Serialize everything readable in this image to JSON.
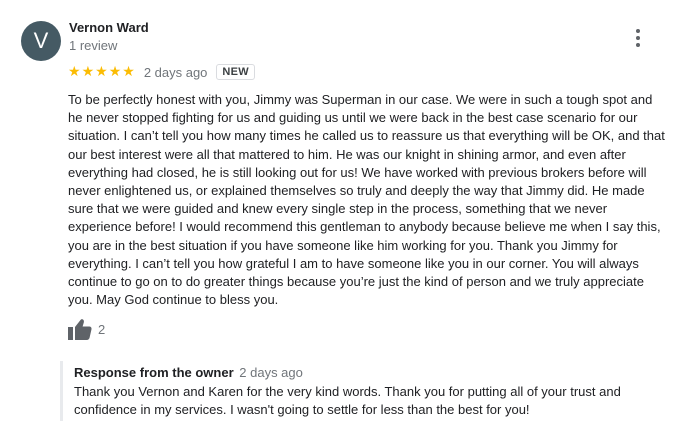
{
  "review": {
    "avatar_initial": "V",
    "avatar_color": "#455a64",
    "reviewer_name": "Vernon Ward",
    "review_count": "1 review",
    "rating": 5,
    "star_color": "#fbbc04",
    "date": "2 days ago",
    "badge": "NEW",
    "text": "To be perfectly honest with you, Jimmy was Superman in our case. We were in such a tough spot and he never stopped fighting for us and guiding us until we were back in  the best case scenario for our situation. I can’t tell you how many times he called us to reassure us that everything will be OK, and that our best interest were  all that mattered to him. He was our knight in shining armor, and even after everything had closed, he is still looking out for us! We have worked with previous brokers before will never enlightened us, or explained themselves so truly and deeply the way that Jimmy did. He made sure that we were guided and knew every single step in the process, something that we never experience before! I would recommend this gentleman to anybody because believe me when I say this, you are in the best situation if you have someone like him working for you. Thank you Jimmy for everything. I can’t tell you how grateful I am to have someone like you in our corner. You will always continue to go on to do greater things because you’re just the kind of person and we truly appreciate you. May God continue to bless you.",
    "like_count": "2",
    "more_icon": "more-vert-icon",
    "like_icon": "thumb-up-icon"
  },
  "owner_response": {
    "title": "Response from the owner",
    "date": "2 days ago",
    "text": "Thank you Vernon and Karen for the very kind words. Thank you for putting all of your trust and confidence in my services. I wasn't going to settle for less than the best for you!"
  }
}
